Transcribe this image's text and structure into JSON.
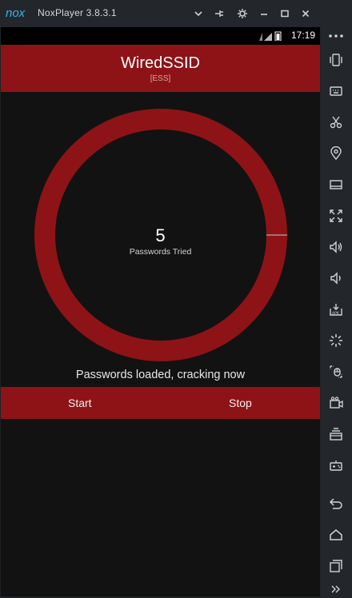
{
  "window": {
    "app_title": "NoxPlayer 3.8.3.1",
    "logo_text": "nox"
  },
  "colors": {
    "accent": "#8e1317",
    "screen_bg": "#121212",
    "chrome_bg": "#23272c"
  },
  "titlebar": {
    "controls": [
      "chevron-down-icon",
      "pin-icon",
      "gear-icon",
      "minimize-icon",
      "maximize-icon",
      "close-icon"
    ]
  },
  "statusbar": {
    "time": "17:19",
    "icons": [
      "sim-icon",
      "signal-icon",
      "battery-icon"
    ]
  },
  "app": {
    "ssid": "WiredSSID",
    "network_type": "[ESS]",
    "passwords_tried_count": "5",
    "passwords_tried_label": "Passwords Tried",
    "progress_fraction": 0.0,
    "status_message": "Passwords loaded, cracking now",
    "start_label": "Start",
    "stop_label": "Stop"
  },
  "sidebar": {
    "items": [
      "more-icon",
      "shake-icon",
      "keyboard-icon",
      "scissors-icon",
      "location-icon",
      "screen-icon",
      "fullscreen-icon",
      "volume-up-icon",
      "volume-down-icon",
      "apk-icon",
      "loading-icon",
      "macro-icon",
      "video-record-icon",
      "multi-instance-icon",
      "gamepad-icon",
      "back-icon",
      "home-icon",
      "recents-icon",
      "expand-icon"
    ]
  }
}
